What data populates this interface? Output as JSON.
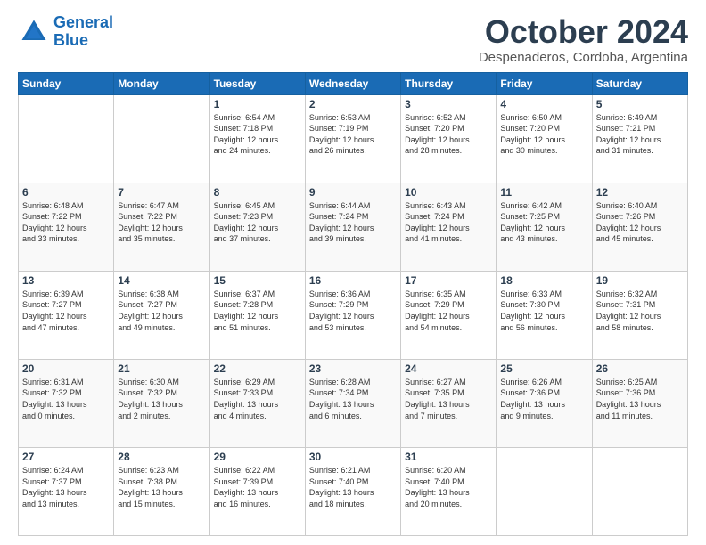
{
  "logo": {
    "text_general": "General",
    "text_blue": "Blue"
  },
  "header": {
    "title": "October 2024",
    "subtitle": "Despenaderos, Cordoba, Argentina"
  },
  "weekdays": [
    "Sunday",
    "Monday",
    "Tuesday",
    "Wednesday",
    "Thursday",
    "Friday",
    "Saturday"
  ],
  "weeks": [
    [
      {
        "day": "",
        "info": ""
      },
      {
        "day": "",
        "info": ""
      },
      {
        "day": "1",
        "info": "Sunrise: 6:54 AM\nSunset: 7:18 PM\nDaylight: 12 hours\nand 24 minutes."
      },
      {
        "day": "2",
        "info": "Sunrise: 6:53 AM\nSunset: 7:19 PM\nDaylight: 12 hours\nand 26 minutes."
      },
      {
        "day": "3",
        "info": "Sunrise: 6:52 AM\nSunset: 7:20 PM\nDaylight: 12 hours\nand 28 minutes."
      },
      {
        "day": "4",
        "info": "Sunrise: 6:50 AM\nSunset: 7:20 PM\nDaylight: 12 hours\nand 30 minutes."
      },
      {
        "day": "5",
        "info": "Sunrise: 6:49 AM\nSunset: 7:21 PM\nDaylight: 12 hours\nand 31 minutes."
      }
    ],
    [
      {
        "day": "6",
        "info": "Sunrise: 6:48 AM\nSunset: 7:22 PM\nDaylight: 12 hours\nand 33 minutes."
      },
      {
        "day": "7",
        "info": "Sunrise: 6:47 AM\nSunset: 7:22 PM\nDaylight: 12 hours\nand 35 minutes."
      },
      {
        "day": "8",
        "info": "Sunrise: 6:45 AM\nSunset: 7:23 PM\nDaylight: 12 hours\nand 37 minutes."
      },
      {
        "day": "9",
        "info": "Sunrise: 6:44 AM\nSunset: 7:24 PM\nDaylight: 12 hours\nand 39 minutes."
      },
      {
        "day": "10",
        "info": "Sunrise: 6:43 AM\nSunset: 7:24 PM\nDaylight: 12 hours\nand 41 minutes."
      },
      {
        "day": "11",
        "info": "Sunrise: 6:42 AM\nSunset: 7:25 PM\nDaylight: 12 hours\nand 43 minutes."
      },
      {
        "day": "12",
        "info": "Sunrise: 6:40 AM\nSunset: 7:26 PM\nDaylight: 12 hours\nand 45 minutes."
      }
    ],
    [
      {
        "day": "13",
        "info": "Sunrise: 6:39 AM\nSunset: 7:27 PM\nDaylight: 12 hours\nand 47 minutes."
      },
      {
        "day": "14",
        "info": "Sunrise: 6:38 AM\nSunset: 7:27 PM\nDaylight: 12 hours\nand 49 minutes."
      },
      {
        "day": "15",
        "info": "Sunrise: 6:37 AM\nSunset: 7:28 PM\nDaylight: 12 hours\nand 51 minutes."
      },
      {
        "day": "16",
        "info": "Sunrise: 6:36 AM\nSunset: 7:29 PM\nDaylight: 12 hours\nand 53 minutes."
      },
      {
        "day": "17",
        "info": "Sunrise: 6:35 AM\nSunset: 7:29 PM\nDaylight: 12 hours\nand 54 minutes."
      },
      {
        "day": "18",
        "info": "Sunrise: 6:33 AM\nSunset: 7:30 PM\nDaylight: 12 hours\nand 56 minutes."
      },
      {
        "day": "19",
        "info": "Sunrise: 6:32 AM\nSunset: 7:31 PM\nDaylight: 12 hours\nand 58 minutes."
      }
    ],
    [
      {
        "day": "20",
        "info": "Sunrise: 6:31 AM\nSunset: 7:32 PM\nDaylight: 13 hours\nand 0 minutes."
      },
      {
        "day": "21",
        "info": "Sunrise: 6:30 AM\nSunset: 7:32 PM\nDaylight: 13 hours\nand 2 minutes."
      },
      {
        "day": "22",
        "info": "Sunrise: 6:29 AM\nSunset: 7:33 PM\nDaylight: 13 hours\nand 4 minutes."
      },
      {
        "day": "23",
        "info": "Sunrise: 6:28 AM\nSunset: 7:34 PM\nDaylight: 13 hours\nand 6 minutes."
      },
      {
        "day": "24",
        "info": "Sunrise: 6:27 AM\nSunset: 7:35 PM\nDaylight: 13 hours\nand 7 minutes."
      },
      {
        "day": "25",
        "info": "Sunrise: 6:26 AM\nSunset: 7:36 PM\nDaylight: 13 hours\nand 9 minutes."
      },
      {
        "day": "26",
        "info": "Sunrise: 6:25 AM\nSunset: 7:36 PM\nDaylight: 13 hours\nand 11 minutes."
      }
    ],
    [
      {
        "day": "27",
        "info": "Sunrise: 6:24 AM\nSunset: 7:37 PM\nDaylight: 13 hours\nand 13 minutes."
      },
      {
        "day": "28",
        "info": "Sunrise: 6:23 AM\nSunset: 7:38 PM\nDaylight: 13 hours\nand 15 minutes."
      },
      {
        "day": "29",
        "info": "Sunrise: 6:22 AM\nSunset: 7:39 PM\nDaylight: 13 hours\nand 16 minutes."
      },
      {
        "day": "30",
        "info": "Sunrise: 6:21 AM\nSunset: 7:40 PM\nDaylight: 13 hours\nand 18 minutes."
      },
      {
        "day": "31",
        "info": "Sunrise: 6:20 AM\nSunset: 7:40 PM\nDaylight: 13 hours\nand 20 minutes."
      },
      {
        "day": "",
        "info": ""
      },
      {
        "day": "",
        "info": ""
      }
    ]
  ]
}
